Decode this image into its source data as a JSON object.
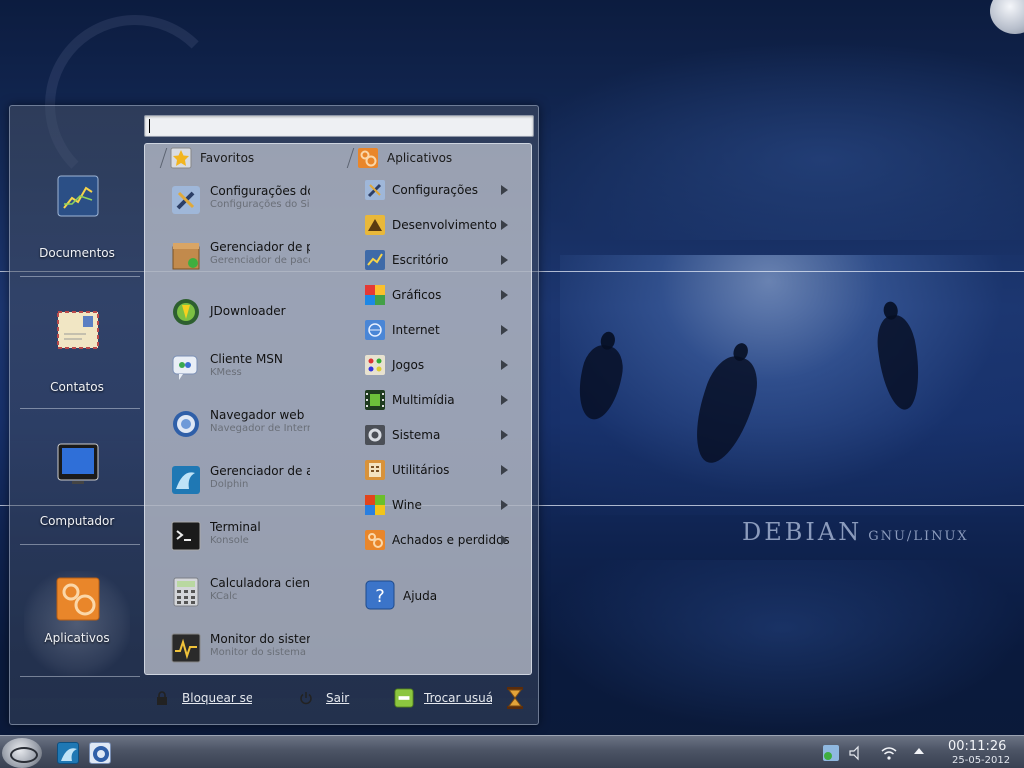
{
  "desktop": {
    "brand": "Debian",
    "brand_suffix": "GNU/Linux"
  },
  "launcher": {
    "search": {
      "value": "",
      "placeholder": ""
    },
    "sidebar": [
      {
        "label": "Documentos",
        "icon": "chart-document-icon"
      },
      {
        "label": "Contatos",
        "icon": "contacts-envelope-icon"
      },
      {
        "label": "Computador",
        "icon": "computer-monitor-icon"
      },
      {
        "label": "Aplicativos",
        "icon": "gears-icon"
      }
    ],
    "favorites_header": "Favoritos",
    "applications_header": "Aplicativos",
    "favorites": [
      {
        "title": "Configurações do Sistema",
        "subtitle": "Configurações do Sistema",
        "icon": "wrench-screwdriver-icon"
      },
      {
        "title": "Gerenciador de pacotes",
        "subtitle": "Gerenciador de pacotes",
        "icon": "package-box-icon"
      },
      {
        "title": "JDownloader",
        "subtitle": "",
        "icon": "jdownloader-globe-icon"
      },
      {
        "title": "Cliente MSN",
        "subtitle": "KMess",
        "icon": "msn-chat-icon"
      },
      {
        "title": "Navegador web",
        "subtitle": "Navegador de Internet",
        "icon": "web-browser-icon"
      },
      {
        "title": "Gerenciador de arquivos",
        "subtitle": "Dolphin",
        "icon": "dolphin-icon"
      },
      {
        "title": "Terminal",
        "subtitle": "Konsole",
        "icon": "terminal-icon"
      },
      {
        "title": "Calculadora científica",
        "subtitle": "KCalc",
        "icon": "calculator-icon"
      },
      {
        "title": "Monitor do sistema",
        "subtitle": "Monitor do sistema",
        "icon": "system-monitor-icon"
      }
    ],
    "applications": [
      {
        "label": "Configurações",
        "icon": "settings-icon"
      },
      {
        "label": "Desenvolvimento",
        "icon": "development-icon"
      },
      {
        "label": "Escritório",
        "icon": "office-icon"
      },
      {
        "label": "Gráficos",
        "icon": "graphics-icon"
      },
      {
        "label": "Internet",
        "icon": "internet-icon"
      },
      {
        "label": "Jogos",
        "icon": "games-icon"
      },
      {
        "label": "Multimídia",
        "icon": "multimedia-icon"
      },
      {
        "label": "Sistema",
        "icon": "system-icon"
      },
      {
        "label": "Utilitários",
        "icon": "utilities-icon"
      },
      {
        "label": "Wine",
        "icon": "wine-icon"
      },
      {
        "label": "Achados e perdidos",
        "icon": "lost-found-icon"
      }
    ],
    "help_label": "Ajuda",
    "bottom": {
      "lock": "Bloquear sessão",
      "logout": "Sair",
      "switch_user": "Trocar usuário"
    }
  },
  "taskbar": {
    "time": "00:11:26",
    "date": "25-05-2012"
  }
}
